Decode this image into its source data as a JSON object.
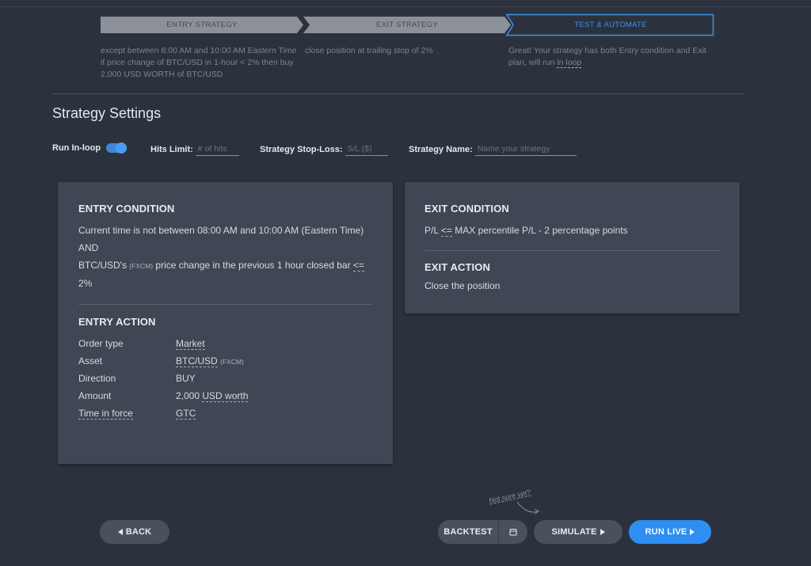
{
  "stepper": {
    "steps": [
      {
        "label": "ENTRY STRATEGY",
        "description": "except between 8:00 AM and 10:00 AM Eastern Time if price change of BTC/USD in 1-hour < 2% then buy 2,000 USD WORTH of BTC/USD"
      },
      {
        "label": "EXIT STRATEGY",
        "description": "close position at trailing stop of 2%"
      },
      {
        "label": "TEST & AUTOMATE",
        "description_prefix": "Great! Your strategy has both Entry condition and Exit plan, will run ",
        "description_link": "in loop"
      }
    ]
  },
  "page_title": "Strategy Settings",
  "settings": {
    "run_in_loop_label": "Run In-loop",
    "run_in_loop_on": true,
    "hits_limit_label": "Hits Limit:",
    "hits_limit_placeholder": "# of hits",
    "stop_loss_label": "Strategy Stop-Loss:",
    "stop_loss_placeholder": "S/L ($)",
    "name_label": "Strategy Name:",
    "name_placeholder": "Name your strategy"
  },
  "entry": {
    "condition_title": "ENTRY CONDITION",
    "condition_line1": "Current time is not between 08:00 AM and 10:00 AM (Eastern Time)",
    "condition_and": "AND",
    "condition_line2_a": "BTC/USD's",
    "condition_line2_src": "(FXCM)",
    "condition_line2_b": "price change in the previous 1 hour closed bar",
    "condition_line2_op": "<=",
    "condition_line2_c": "2%",
    "action_title": "ENTRY ACTION",
    "rows": {
      "order_type_k": "Order type",
      "order_type_v": "Market",
      "asset_k": "Asset",
      "asset_v": "BTC/USD",
      "asset_src": "(FXCM)",
      "direction_k": "Direction",
      "direction_v": "BUY",
      "amount_k": "Amount",
      "amount_num": "2,000",
      "amount_unit": "USD worth",
      "tif_k": "Time in force",
      "tif_v": "GTC"
    }
  },
  "exit": {
    "condition_title": "EXIT CONDITION",
    "condition_a": "P/L",
    "condition_op": "<=",
    "condition_b": "MAX percentile P/L - 2 percentage points",
    "action_title": "EXIT ACTION",
    "action_text": "Close the position"
  },
  "buttons": {
    "back": "BACK",
    "backtest": "BACKTEST",
    "simulate": "SIMULATE",
    "run_live": "RUN LIVE",
    "not_sure": "Not sure yet?"
  },
  "colors": {
    "background": "#2c323d",
    "card": "#3f4654",
    "accent": "#2f8ef2"
  }
}
